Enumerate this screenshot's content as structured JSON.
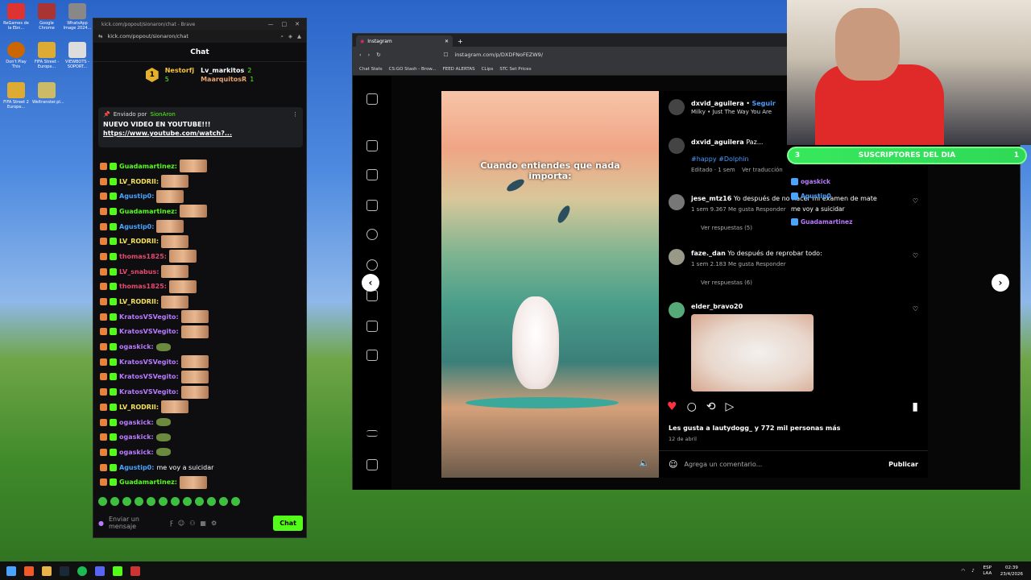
{
  "desktop": {
    "icons": [
      {
        "label": "ReGames de la Ebn...",
        "color": "#d33"
      },
      {
        "label": "Google Chrome",
        "color": "#a33"
      },
      {
        "label": "WhatsApp Image 2024...",
        "color": "#888"
      },
      {
        "label": "Don't Play This",
        "color": "#c60"
      },
      {
        "label": "FIFA Street - Europe...",
        "color": "#da3"
      },
      {
        "label": "VIEWBOTS - SOPORT...",
        "color": "#ddd"
      },
      {
        "label": "FIFA Street 2 Europe...",
        "color": "#da3"
      },
      {
        "label": "Weltranster.pl...",
        "color": "#cb6"
      }
    ]
  },
  "chat_window": {
    "title": "kick.com/popout/sionaron/chat - Brave",
    "url": "kick.com/popout/sionaron/chat",
    "header": "Chat",
    "leaderboard": {
      "rank": "1",
      "top_user": "Nestorfj",
      "top_count": "5",
      "second": {
        "name": "Lv_markitos",
        "count": "2"
      },
      "third": {
        "name": "MaarquitosR",
        "count": "1"
      }
    },
    "pinned": {
      "sent_by_label": "Enviado por",
      "sent_by_user": "SionAron",
      "message": "NUEVO VIDEO EN YOUTUBE!!!",
      "link": "https://www.youtube.com/watch?..."
    },
    "messages": [
      {
        "user": "Guadamartinez:",
        "color": "#53fc18",
        "text": ""
      },
      {
        "user": "LV_RODRII:",
        "color": "#f5e05a",
        "text": ""
      },
      {
        "user": "Agustip0:",
        "color": "#4aa3ff",
        "text": ""
      },
      {
        "user": "Guadamartinez:",
        "color": "#53fc18",
        "text": ""
      },
      {
        "user": "Agustip0:",
        "color": "#4aa3ff",
        "text": ""
      },
      {
        "user": "LV_RODRII:",
        "color": "#f5e05a",
        "text": ""
      },
      {
        "user": "thomas1825:",
        "color": "#e34a6f",
        "text": ""
      },
      {
        "user": "LV_snabus:",
        "color": "#e34a6f",
        "text": ""
      },
      {
        "user": "thomas1825:",
        "color": "#e34a6f",
        "text": ""
      },
      {
        "user": "LV_RODRII:",
        "color": "#f5e05a",
        "text": ""
      },
      {
        "user": "KratosVSVegito:",
        "color": "#b87aff",
        "text": ""
      },
      {
        "user": "KratosVSVegito:",
        "color": "#b87aff",
        "text": ""
      },
      {
        "user": "ogaskick:",
        "color": "#b87aff",
        "text": ""
      },
      {
        "user": "KratosVSVegito:",
        "color": "#b87aff",
        "text": ""
      },
      {
        "user": "KratosVSVegito:",
        "color": "#b87aff",
        "text": ""
      },
      {
        "user": "KratosVSVegito:",
        "color": "#b87aff",
        "text": ""
      },
      {
        "user": "LV_RODRII:",
        "color": "#f5e05a",
        "text": ""
      },
      {
        "user": "ogaskick:",
        "color": "#b87aff",
        "text": ""
      },
      {
        "user": "ogaskick:",
        "color": "#b87aff",
        "text": ""
      },
      {
        "user": "ogaskick:",
        "color": "#b87aff",
        "text": ""
      },
      {
        "user": "Agustip0:",
        "color": "#4aa3ff",
        "text": "me voy a suicidar"
      },
      {
        "user": "Guadamartinez:",
        "color": "#53fc18",
        "text": ""
      }
    ],
    "input_placeholder": "Enviar un mensaje",
    "send_label": "Chat"
  },
  "browser": {
    "tab_title": "Instagram",
    "url": "instagram.com/p/DXDFNoFEZW9/",
    "bookmarks": [
      "Chat Stats",
      "CS:GO Stash - Brow...",
      "FEED ALERTAS",
      "CLips",
      "STC Set Prices"
    ],
    "post": {
      "caption": "Cuando entiendes que nada importa:",
      "author": "dxvid_aguilera",
      "follow": "Seguir",
      "song": "Milky • Just The Way You Are",
      "author_comment": "Paz...",
      "hashtags": "#happy #Dolphin",
      "edited": "Editado · 1 sem",
      "translate": "Ver traducción",
      "comments": [
        {
          "user": "jese_mtz16",
          "text": "Yo después de no hacer mi examen de mate",
          "meta": "1 sem  9.367 Me gusta  Responder",
          "replies": "Ver respuestas (5)"
        },
        {
          "user": "faze._dan",
          "text": "Yo después de reprobar todo:",
          "meta": "1 sem  2.183 Me gusta  Responder",
          "replies": "Ver respuestas (6)"
        },
        {
          "user": "elder_bravo20",
          "text": "",
          "meta": "",
          "replies": ""
        }
      ],
      "likes": "Les gusta a lautydogg_ y 772 mil personas más",
      "date": "12 de abril",
      "add_comment": "Agrega un comentario...",
      "publish": "Publicar"
    }
  },
  "overlay": {
    "subs_count_left": "3",
    "subs_title": "SUSCRIPTORES DEL DIA",
    "subs_count_right": "1",
    "subs": [
      {
        "name": "ogaskick",
        "color": "#b87aff",
        "msg": ""
      },
      {
        "name": "Agustip0",
        "color": "#4aa3ff",
        "msg": "me voy a suicidar"
      },
      {
        "name": "Guadamartinez",
        "color": "#b87aff",
        "msg": ""
      }
    ]
  },
  "taskbar": {
    "lang": "ESP LAA",
    "time": "02:39",
    "date": "23/4/2026"
  }
}
